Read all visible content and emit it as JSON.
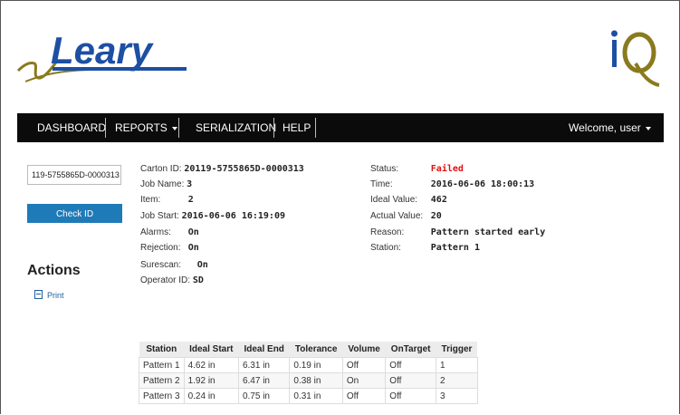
{
  "branding": {
    "logo_text": "Leary",
    "product_logo": "iQ"
  },
  "nav": {
    "dashboard": "DASHBOARD",
    "reports": "REPORTS",
    "serialization": "SERIALIZATION",
    "help": "HELP",
    "welcome": "Welcome, user"
  },
  "sidebar": {
    "carton_input_value": "119-5755865D-0000313",
    "check_button": "Check ID",
    "actions_title": "Actions",
    "print_link": "Print"
  },
  "details": {
    "carton_id_label": "Carton ID:",
    "carton_id": "20119-5755865D-0000313",
    "job_name_label": "Job Name:",
    "job_name": "3",
    "item_label": "Item:",
    "item": "2",
    "job_start_label": "Job Start:",
    "job_start": "2016-06-06 16:19:09",
    "alarms_label": "Alarms:",
    "alarms": "On",
    "rejection_label": "Rejection:",
    "rejection": "On",
    "surescan_label": "Surescan:",
    "surescan": "On",
    "operator_label": "Operator ID:",
    "operator": "SD",
    "status_label": "Status:",
    "status": "Failed",
    "time_label": "Time:",
    "time": "2016-06-06 18:00:13",
    "ideal_value_label": "Ideal Value:",
    "ideal_value": "462",
    "actual_value_label": "Actual Value:",
    "actual_value": "20",
    "reason_label": "Reason:",
    "reason": "Pattern started early",
    "station_label": "Station:",
    "station": "Pattern 1"
  },
  "colors": {
    "status_failed": "#e01010",
    "button": "#1f7ab8",
    "navbar": "#0b0b0b"
  },
  "table": {
    "headers": [
      "Station",
      "Ideal Start",
      "Ideal End",
      "Tolerance",
      "Volume",
      "OnTarget",
      "Trigger"
    ],
    "rows": [
      [
        "Pattern 1",
        "4.62 in",
        "6.31 in",
        "0.19 in",
        "Off",
        "Off",
        "1"
      ],
      [
        "Pattern 2",
        "1.92 in",
        "6.47 in",
        "0.38 in",
        "On",
        "Off",
        "2"
      ],
      [
        "Pattern 3",
        "0.24 in",
        "0.75 in",
        "0.31 in",
        "Off",
        "Off",
        "3"
      ]
    ]
  }
}
